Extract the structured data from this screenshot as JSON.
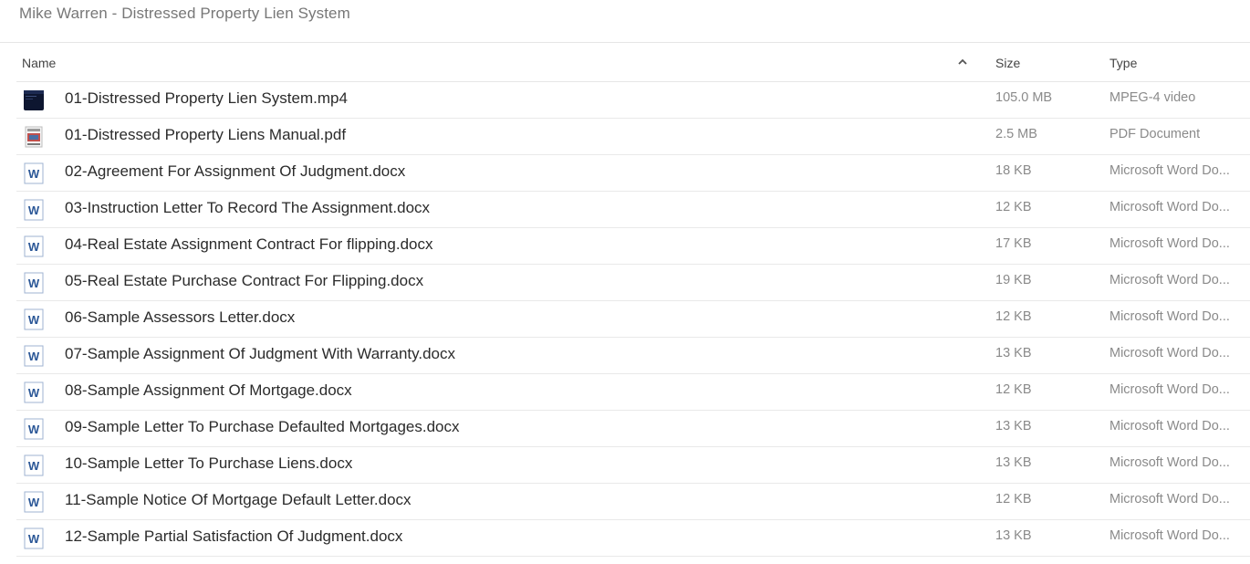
{
  "page": {
    "title": "Mike Warren - Distressed Property Lien System"
  },
  "table": {
    "headers": {
      "name": "Name",
      "size": "Size",
      "type": "Type"
    },
    "sort": {
      "column": "name",
      "direction": "ascending",
      "icon": "chevron-up-icon"
    },
    "files": [
      {
        "name": "01-Distressed Property Lien System.mp4",
        "size": "105.0 MB",
        "type": "MPEG-4 video",
        "icon": "video-thumbnail-icon"
      },
      {
        "name": "01-Distressed Property Liens Manual.pdf",
        "size": "2.5 MB",
        "type": "PDF Document",
        "icon": "pdf-thumbnail-icon"
      },
      {
        "name": "02-Agreement For Assignment Of Judgment.docx",
        "size": "18 KB",
        "type": "Microsoft Word Do...",
        "icon": "word-doc-icon"
      },
      {
        "name": "03-Instruction Letter To Record The Assignment.docx",
        "size": "12 KB",
        "type": "Microsoft Word Do...",
        "icon": "word-doc-icon"
      },
      {
        "name": "04-Real Estate Assignment Contract For flipping.docx",
        "size": "17 KB",
        "type": "Microsoft Word Do...",
        "icon": "word-doc-icon"
      },
      {
        "name": "05-Real Estate Purchase Contract For Flipping.docx",
        "size": "19 KB",
        "type": "Microsoft Word Do...",
        "icon": "word-doc-icon"
      },
      {
        "name": "06-Sample Assessors Letter.docx",
        "size": "12 KB",
        "type": "Microsoft Word Do...",
        "icon": "word-doc-icon"
      },
      {
        "name": "07-Sample Assignment Of Judgment With Warranty.docx",
        "size": "13 KB",
        "type": "Microsoft Word Do...",
        "icon": "word-doc-icon"
      },
      {
        "name": "08-Sample Assignment Of Mortgage.docx",
        "size": "12 KB",
        "type": "Microsoft Word Do...",
        "icon": "word-doc-icon"
      },
      {
        "name": "09-Sample Letter To Purchase Defaulted Mortgages.docx",
        "size": "13 KB",
        "type": "Microsoft Word Do...",
        "icon": "word-doc-icon"
      },
      {
        "name": "10-Sample Letter To Purchase Liens.docx",
        "size": "13 KB",
        "type": "Microsoft Word Do...",
        "icon": "word-doc-icon"
      },
      {
        "name": "11-Sample Notice Of Mortgage Default Letter.docx",
        "size": "12 KB",
        "type": "Microsoft Word Do...",
        "icon": "word-doc-icon"
      },
      {
        "name": "12-Sample Partial Satisfaction Of Judgment.docx",
        "size": "13 KB",
        "type": "Microsoft Word Do...",
        "icon": "word-doc-icon"
      }
    ]
  },
  "colors": {
    "word_blue": "#2b5797",
    "divider": "#e6e6e6",
    "muted_text": "#8a8a8a"
  }
}
